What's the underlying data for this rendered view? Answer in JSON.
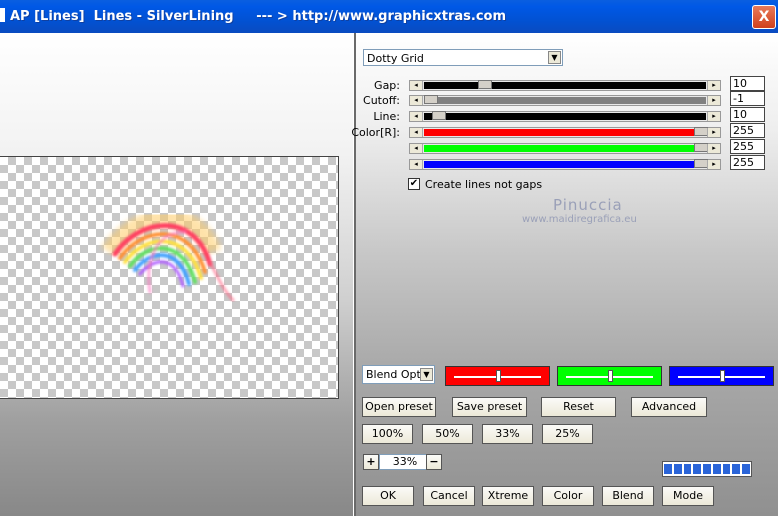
{
  "window": {
    "title": "AP [Lines]  Lines - SilverLining     --- > http://www.graphicxtras.com",
    "close_glyph": "X"
  },
  "preset": {
    "selected": "Dotty Grid"
  },
  "params": [
    {
      "label": "Gap:",
      "value": "10",
      "fill_color": "#000000",
      "thumb_fraction": 0.2
    },
    {
      "label": "Cutoff:",
      "value": "-1",
      "fill_color": "#808080",
      "thumb_fraction": 0.0
    },
    {
      "label": "Line:",
      "value": "10",
      "fill_color": "#000000",
      "thumb_fraction": 0.03
    },
    {
      "label": "Color[R]:",
      "value": "255",
      "fill_color": "#ff0000",
      "thumb_fraction": 1.0
    },
    {
      "label": "",
      "value": "255",
      "fill_color": "#00ff00",
      "thumb_fraction": 1.0
    },
    {
      "label": "",
      "value": "255",
      "fill_color": "#0000ff",
      "thumb_fraction": 1.0
    }
  ],
  "options": {
    "create_lines_label": "Create lines not gaps",
    "create_lines_checked": true
  },
  "watermark": {
    "name": "Pinuccia",
    "url": "www.maidiregrafica.eu"
  },
  "blend": {
    "selected": "Blend Optio"
  },
  "color_channels": [
    {
      "color": "#ff0000",
      "level": 0.5
    },
    {
      "color": "#00ff00",
      "level": 0.5
    },
    {
      "color": "#0000ff",
      "level": 0.5
    }
  ],
  "buttons": {
    "open_preset": "Open preset",
    "save_preset": "Save preset",
    "reset": "Reset",
    "advanced": "Advanced",
    "ok": "OK",
    "cancel": "Cancel",
    "xtreme": "Xtreme",
    "color": "Color",
    "blend": "Blend",
    "mode": "Mode"
  },
  "zoom_buttons": [
    "100%",
    "50%",
    "33%",
    "25%"
  ],
  "zoom": {
    "value": "33%",
    "plus": "+",
    "minus": "−"
  },
  "progress": {
    "segments": 9,
    "fraction": 1.0
  },
  "colors": {
    "titlebar": "#0058e6",
    "progress": "#2a64d8"
  }
}
